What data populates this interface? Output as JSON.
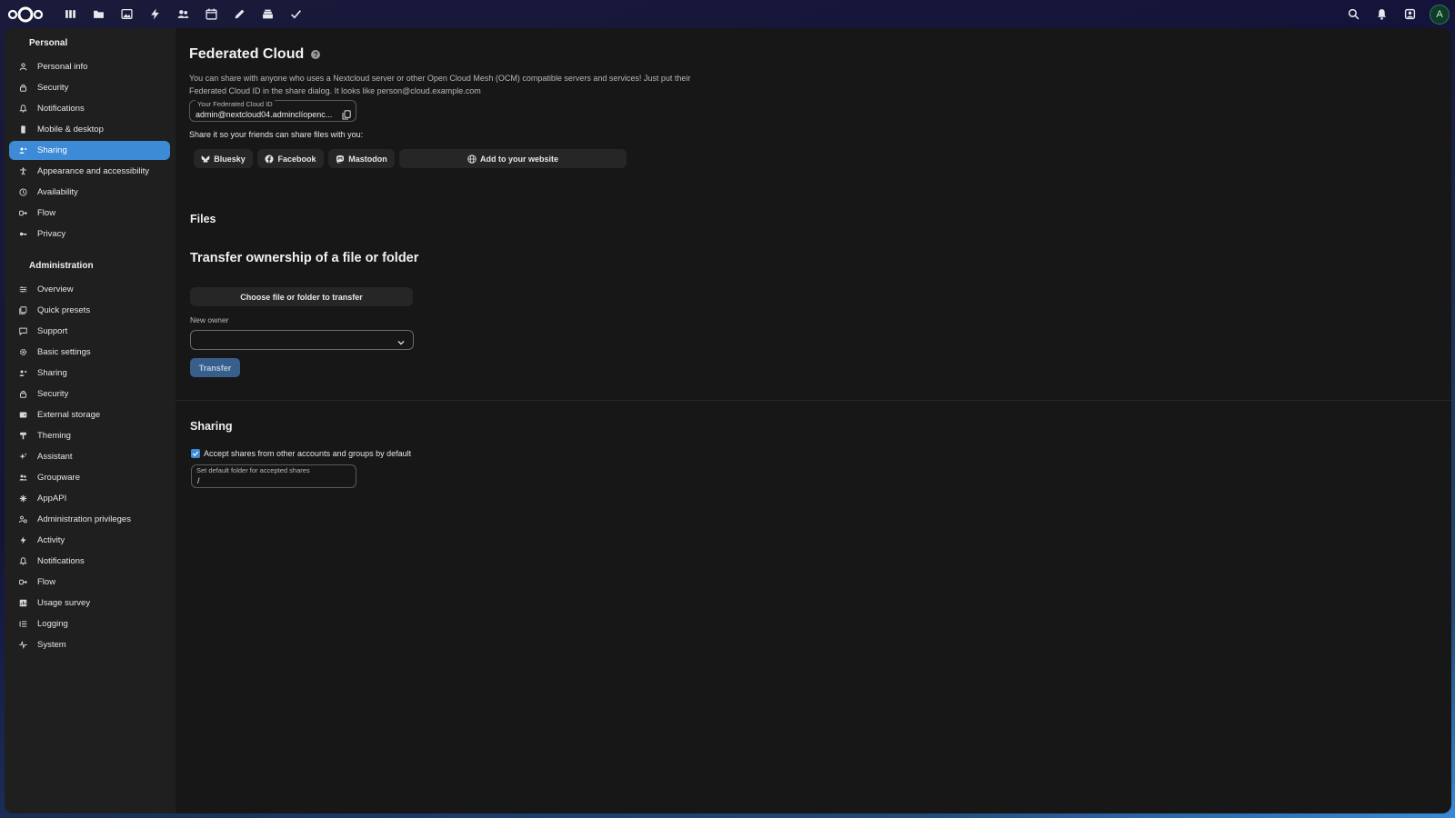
{
  "topbar": {
    "apps": [
      "dashboard-icon",
      "files-icon",
      "photos-icon",
      "activity-icon",
      "contacts-icon",
      "calendar-icon",
      "notes-icon",
      "deck-icon",
      "tasks-icon"
    ],
    "right_icons": [
      "search-icon",
      "notifications-icon",
      "contacts-menu-icon"
    ],
    "avatar_initial": "A"
  },
  "sidebar": {
    "personal_caption": "Personal",
    "personal_items": [
      {
        "label": "Personal info",
        "icon": "user-icon"
      },
      {
        "label": "Security",
        "icon": "lock-icon"
      },
      {
        "label": "Notifications",
        "icon": "bell-icon"
      },
      {
        "label": "Mobile & desktop",
        "icon": "phone-icon"
      },
      {
        "label": "Sharing",
        "icon": "share-icon",
        "active": true
      },
      {
        "label": "Appearance and accessibility",
        "icon": "accessibility-icon"
      },
      {
        "label": "Availability",
        "icon": "clock-icon"
      },
      {
        "label": "Flow",
        "icon": "flow-icon"
      },
      {
        "label": "Privacy",
        "icon": "key-icon"
      }
    ],
    "admin_caption": "Administration",
    "admin_items": [
      {
        "label": "Overview",
        "icon": "sliders-icon"
      },
      {
        "label": "Quick presets",
        "icon": "presets-icon"
      },
      {
        "label": "Support",
        "icon": "chat-icon"
      },
      {
        "label": "Basic settings",
        "icon": "gear-icon"
      },
      {
        "label": "Sharing",
        "icon": "share-icon"
      },
      {
        "label": "Security",
        "icon": "lock-icon"
      },
      {
        "label": "External storage",
        "icon": "storage-icon"
      },
      {
        "label": "Theming",
        "icon": "brush-icon"
      },
      {
        "label": "Assistant",
        "icon": "sparkle-icon"
      },
      {
        "label": "Groupware",
        "icon": "group-icon"
      },
      {
        "label": "AppAPI",
        "icon": "api-icon"
      },
      {
        "label": "Administration privileges",
        "icon": "admin-icon"
      },
      {
        "label": "Activity",
        "icon": "activity-icon"
      },
      {
        "label": "Notifications",
        "icon": "bell-icon"
      },
      {
        "label": "Flow",
        "icon": "flow-icon"
      },
      {
        "label": "Usage survey",
        "icon": "survey-icon"
      },
      {
        "label": "Logging",
        "icon": "list-icon"
      },
      {
        "label": "System",
        "icon": "pulse-icon"
      }
    ]
  },
  "federated": {
    "title": "Federated Cloud",
    "description": "You can share with anyone who uses a Nextcloud server or other Open Cloud Mesh (OCM) compatible servers and services! Just put their Federated Cloud ID in the share dialog. It looks like person@cloud.example.com",
    "id_label": "Your Federated Cloud ID",
    "id_value": "admin@nextcloud04.adminclíopenc...",
    "share_prompt": "Share it so your friends can share files with you:",
    "buttons": {
      "bluesky": "Bluesky",
      "facebook": "Facebook",
      "mastodon": "Mastodon",
      "website": "Add to your website"
    }
  },
  "files": {
    "title": "Files",
    "transfer_title": "Transfer ownership of a file or folder",
    "choose_label": "Choose file or folder to transfer",
    "new_owner_label": "New owner",
    "transfer_label": "Transfer"
  },
  "sharing": {
    "title": "Sharing",
    "accept_label": "Accept shares from other accounts and groups by default",
    "accept_checked": true,
    "folder_label": "Set default folder for accepted shares",
    "folder_value": "/"
  },
  "colors": {
    "accent": "#3d8ad6",
    "panel": "#171717",
    "sidebar": "#1f1f1f"
  }
}
